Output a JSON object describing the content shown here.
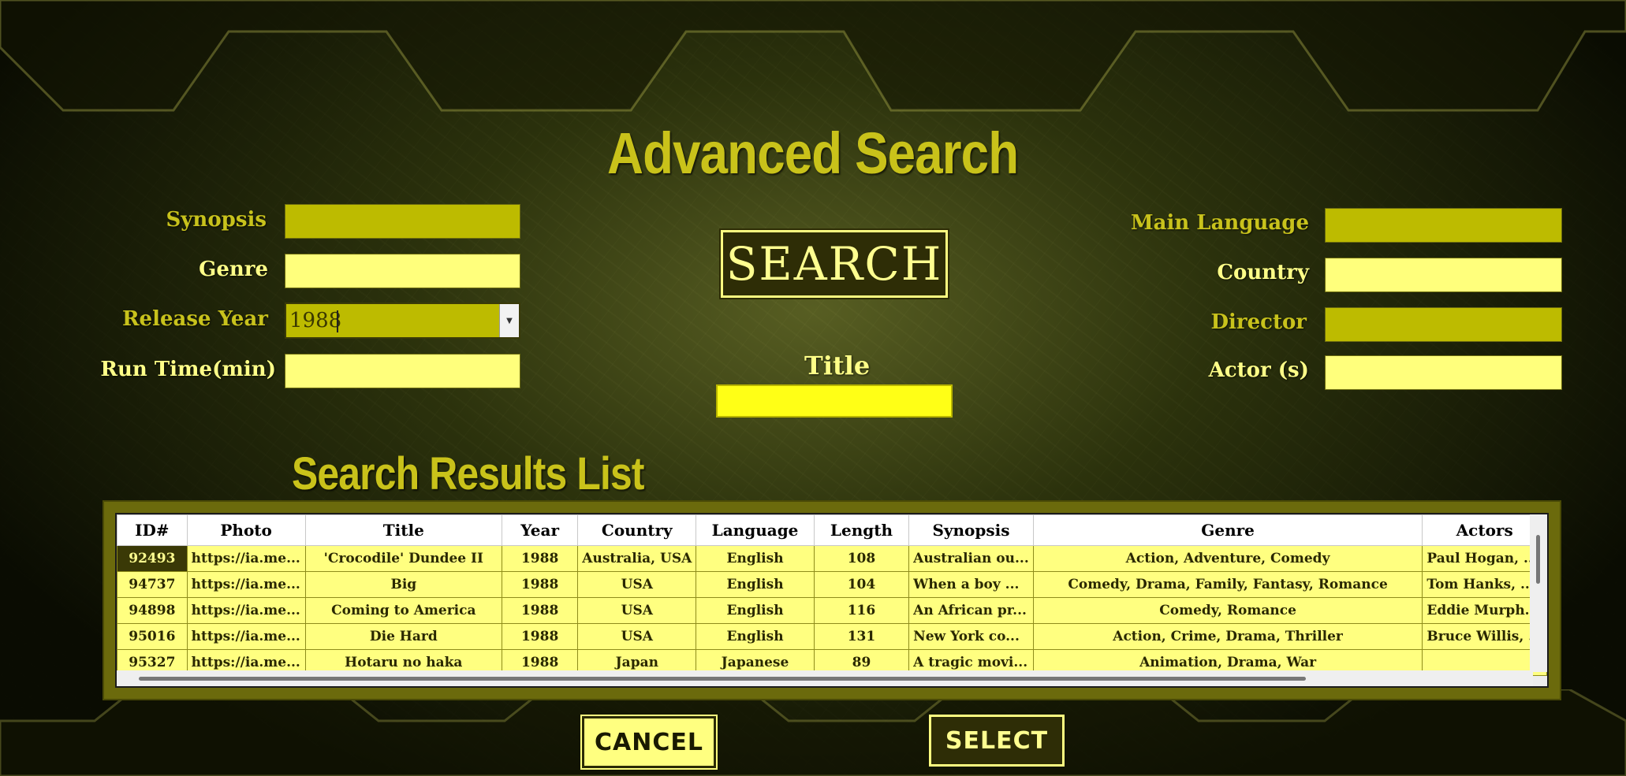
{
  "page_title": "Advanced Search",
  "left_form": {
    "synopsis_label": "Synopsis",
    "synopsis_value": "",
    "genre_label": "Genre",
    "genre_value": "",
    "release_year_label": "Release Year",
    "release_year_value": "1988",
    "runtime_label": "Run Time(min)",
    "runtime_value": ""
  },
  "center": {
    "search_button": "SEARCH",
    "title_label": "Title",
    "title_value": ""
  },
  "right_form": {
    "language_label": "Main Language",
    "language_value": "",
    "country_label": "Country",
    "country_value": "",
    "director_label": "Director",
    "director_value": "",
    "actors_label": "Actor (s)",
    "actors_value": ""
  },
  "results": {
    "heading": "Search Results List",
    "columns": [
      "ID#",
      "Photo",
      "Title",
      "Year",
      "Country",
      "Language",
      "Length",
      "Synopsis",
      "Genre",
      "Actors"
    ],
    "rows": [
      [
        "92493",
        "https://ia.me...",
        "'Crocodile' Dundee II",
        "1988",
        "Australia, USA",
        "English",
        "108",
        "Australian ou...",
        "Action, Adventure, Comedy",
        "Paul Hogan, ..."
      ],
      [
        "94737",
        "https://ia.me...",
        "Big",
        "1988",
        "USA",
        "English",
        "104",
        "When a boy ...",
        "Comedy, Drama, Family, Fantasy, Romance",
        "Tom Hanks, ..."
      ],
      [
        "94898",
        "https://ia.me...",
        "Coming to America",
        "1988",
        "USA",
        "English",
        "116",
        "An African pr...",
        "Comedy, Romance",
        "Eddie Murph..."
      ],
      [
        "95016",
        "https://ia.me...",
        "Die Hard",
        "1988",
        "USA",
        "English",
        "131",
        "New York co...",
        "Action, Crime, Drama, Thriller",
        "Bruce Willis, ..."
      ],
      [
        "95327",
        "https://ia.me...",
        "Hotaru no haka",
        "1988",
        "Japan",
        "Japanese",
        "89",
        "A tragic movi...",
        "Animation, Drama, War",
        ""
      ]
    ]
  },
  "buttons": {
    "cancel": "CANCEL",
    "select": "SELECT"
  },
  "colors": {
    "accent": "#c9c21a",
    "field_dark": "#bdbb00",
    "field_light": "#ffff7c",
    "button_dark": "#2e2d06",
    "row_bg": "#ffff80"
  }
}
